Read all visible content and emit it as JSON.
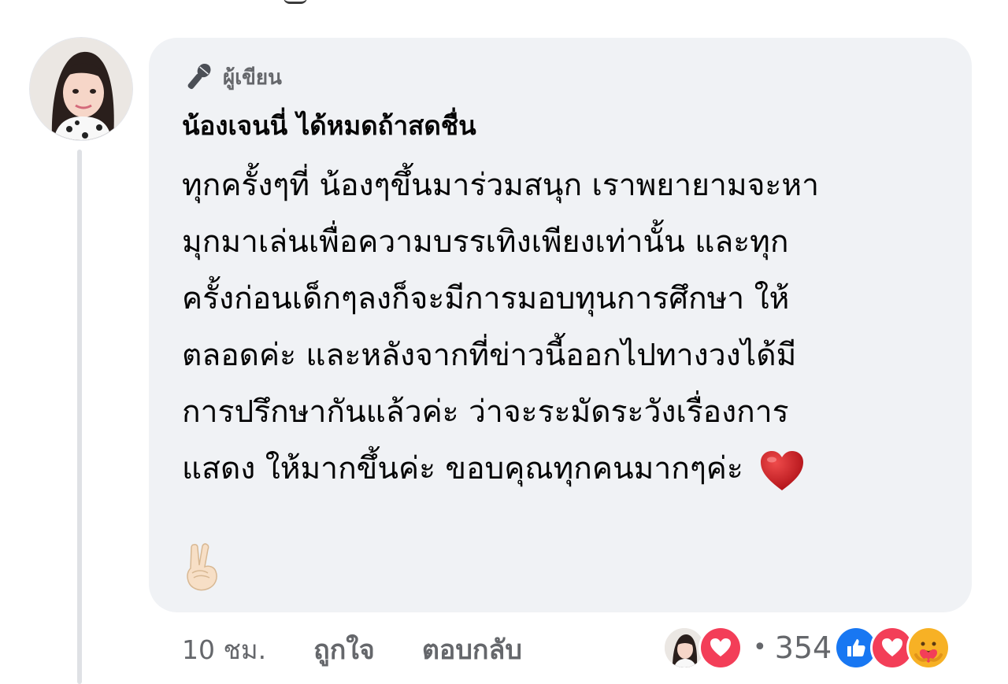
{
  "comment": {
    "author_badge": "ผู้เขียน",
    "author_name": "น้องเจนนี่ ได้หมดถ้าสดชื่น",
    "text_lines": [
      "ทุกครั้งๆที่ น้องๆขึ้นมาร่วมสนุก เราพยายามจะหา",
      "มุกมาเล่นเพื่อความบรรเทิงเพียงเท่านั้น และทุก",
      "ครั้งก่อนเด็กๆลงก็จะมีการมอบทุนการศึกษา ให้",
      "ตลอดค่ะ และหลังจากที่ข่าวนี้ออกไปทางวงได้มี",
      "การปรึกษากันแล้วค่ะ ว่าจะระมัดระวังเรื่องการ",
      "แสดง ให้มากขึ้นค่ะ ขอบคุณทุกคนมากๆค่ะ"
    ],
    "emojis": [
      "heart-emoji",
      "victory-hand-emoji"
    ]
  },
  "actions": {
    "timestamp": "10 ชม.",
    "like_label": "ถูกใจ",
    "reply_label": "ตอบกลับ"
  },
  "reactions": {
    "separator": "•",
    "count": "354",
    "icons": [
      "love",
      "like",
      "love",
      "care"
    ]
  },
  "colors": {
    "bubble_bg": "#f0f2f5",
    "secondary_text": "#65676b",
    "like_blue": "#1877f2",
    "love_red": "#f33e58",
    "care_yellow": "#f7b125"
  }
}
